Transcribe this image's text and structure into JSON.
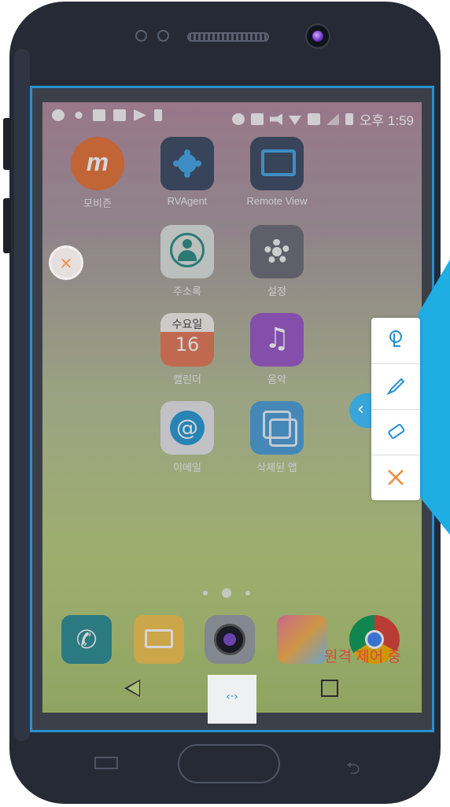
{
  "status_bar": {
    "time": "오후 1:59"
  },
  "apps": [
    {
      "label": "모비즌",
      "icon": "mobizen-icon"
    },
    {
      "label": "RVAgent",
      "icon": "rvagent-icon"
    },
    {
      "label": "Remote View",
      "icon": "remote-view-icon"
    },
    {
      "label": "주소록",
      "icon": "contacts-icon"
    },
    {
      "label": "설정",
      "icon": "settings-icon"
    },
    {
      "label": "수요일",
      "icon": "calendar-icon"
    },
    {
      "label": "캘린더",
      "icon": "calendar-icon"
    },
    {
      "label": "음악",
      "icon": "music-icon"
    },
    {
      "label": "이메일",
      "icon": "email-icon"
    },
    {
      "label": "삭제된 앱",
      "icon": "deleted-apps-icon"
    }
  ],
  "calendar": {
    "weekday": "수요일",
    "day": "16"
  },
  "home_pages": {
    "count": 3,
    "active": 2
  },
  "dock": [
    "phone-icon",
    "messages-icon",
    "camera-icon",
    "gallery-icon",
    "chrome-icon"
  ],
  "remote_control_label": "원격 제어 중",
  "toolbar": [
    "touch-pointer-icon",
    "pen-icon",
    "eraser-icon",
    "close-icon"
  ],
  "nav": [
    "back-icon",
    "remote-toggle-icon",
    "recents-icon"
  ],
  "colors": {
    "accent": "#2b8fcf",
    "close": "#f08a3c",
    "remote_label": "#d64a3a"
  }
}
